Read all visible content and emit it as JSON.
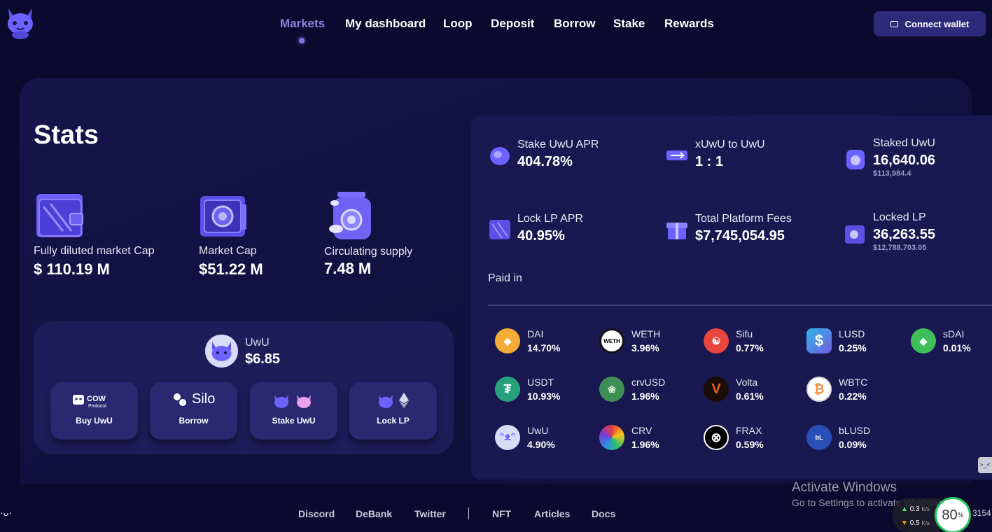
{
  "nav": {
    "items": [
      "Markets",
      "My dashboard",
      "Loop",
      "Deposit",
      "Borrow",
      "Stake",
      "Rewards"
    ],
    "active": "Markets",
    "connect_label": "Connect wallet"
  },
  "stats": {
    "title": "Stats",
    "blocks": [
      {
        "label": "Fully diluted market Cap",
        "value": "$ 110.19 M"
      },
      {
        "label": "Market Cap",
        "value": "$51.22 M"
      },
      {
        "label": "Circulating supply",
        "value": "7.48 M"
      }
    ],
    "token": {
      "name": "UwU",
      "price": "$6.85"
    },
    "actions": [
      {
        "label": "Buy UwU",
        "brand": "COW",
        "brand_sub": "Protocol"
      },
      {
        "label": "Borrow",
        "brand": "Silo"
      },
      {
        "label": "Stake UwU"
      },
      {
        "label": "Lock LP"
      }
    ]
  },
  "metrics": [
    {
      "label": "Stake UwU APR",
      "value": "404.78%",
      "sub": ""
    },
    {
      "label": "xUwU to UwU",
      "value": "1 : 1",
      "sub": ""
    },
    {
      "label": "Staked UwU",
      "value": "16,640.06",
      "sub": "$113,984.4"
    },
    {
      "label": "Lock LP APR",
      "value": "40.95%",
      "sub": ""
    },
    {
      "label": "Total Platform Fees",
      "value": "$7,745,054.95",
      "sub": ""
    },
    {
      "label": "Locked LP",
      "value": "36,263.55",
      "sub": "$12,788,703.05"
    }
  ],
  "paid_in": {
    "title": "Paid in",
    "tokens": [
      {
        "name": "DAI",
        "pct": "14.70%",
        "color": "#f5ac37"
      },
      {
        "name": "WETH",
        "pct": "3.96%",
        "color": "#ffffff"
      },
      {
        "name": "Sifu",
        "pct": "0.77%",
        "color": "#e8453c"
      },
      {
        "name": "LUSD",
        "pct": "0.25%",
        "color": "#2eb6ea"
      },
      {
        "name": "sDAI",
        "pct": "0.01%",
        "color": "#3ebf5a"
      },
      {
        "name": "USDT",
        "pct": "10.93%",
        "color": "#26a17b"
      },
      {
        "name": "crvUSD",
        "pct": "1.96%",
        "color": "#3e8f55"
      },
      {
        "name": "Volta",
        "pct": "0.61%",
        "color": "#c2410c"
      },
      {
        "name": "WBTC",
        "pct": "0.22%",
        "color": "#ffffff"
      },
      {
        "name": "UwU",
        "pct": "4.90%",
        "color": "#d9dcf7"
      },
      {
        "name": "CRV",
        "pct": "1.96%",
        "color": "#e63b3b"
      },
      {
        "name": "FRAX",
        "pct": "0.59%",
        "color": "#000000"
      },
      {
        "name": "bLUSD",
        "pct": "0.09%",
        "color": "#2b4fb8"
      }
    ]
  },
  "footer": {
    "kaomoji": "·ᴗ·",
    "links": [
      "Discord",
      "DeBank",
      "Twitter",
      "NFT",
      "Articles",
      "Docs"
    ]
  },
  "overlay": {
    "activate_title": "Activate Windows",
    "activate_sub": "Go to Settings to activate Windows.",
    "net_up": "0.3",
    "net_down": "0.5",
    "net_unit": "K/s",
    "cpu": "80",
    "cpu_unit": "%",
    "clock_fragment": "3154",
    "side_tab": ">_<"
  }
}
